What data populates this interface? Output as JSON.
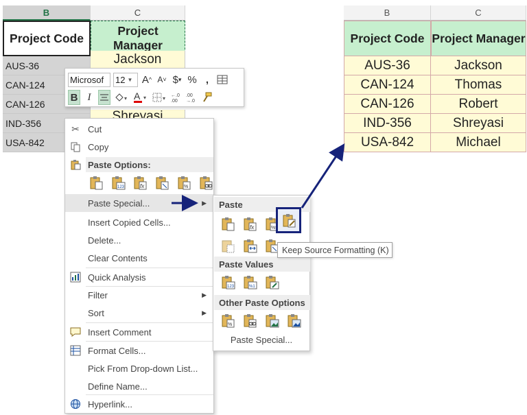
{
  "left_sheet": {
    "col_b": "B",
    "col_c": "C",
    "header_b": "Project Code",
    "header_c": "Project Manager",
    "codes": [
      "AUS-36",
      "CAN-124",
      "CAN-126",
      "IND-356",
      "USA-842"
    ],
    "managers_visible": [
      "Jackson",
      "Shreyasi"
    ]
  },
  "mini_toolbar": {
    "font_name": "Microsof",
    "font_size": "12",
    "grow_font": "A",
    "shrink_font": "A",
    "currency": "$",
    "percent": "%",
    "comma": ",",
    "bold": "B",
    "italic": "I"
  },
  "context_menu": {
    "cut": "Cut",
    "copy": "Copy",
    "paste_options_header": "Paste Options:",
    "paste_special": "Paste Special...",
    "insert_copied_cells": "Insert Copied Cells...",
    "delete": "Delete...",
    "clear_contents": "Clear Contents",
    "quick_analysis": "Quick Analysis",
    "filter": "Filter",
    "sort": "Sort",
    "insert_comment": "Insert Comment",
    "format_cells": "Format Cells...",
    "pick_from_list": "Pick From Drop-down List...",
    "define_name": "Define Name...",
    "hyperlink": "Hyperlink..."
  },
  "submenu": {
    "paste_header": "Paste",
    "paste_values_header": "Paste Values",
    "other_paste_header": "Other Paste Options",
    "paste_special": "Paste Special..."
  },
  "tooltip": "Keep Source Formatting (K)",
  "right_sheet": {
    "col_b": "B",
    "col_c": "C",
    "header_b": "Project Code",
    "header_c": "Project Manager",
    "rows": [
      {
        "code": "AUS-36",
        "manager": "Jackson"
      },
      {
        "code": "CAN-124",
        "manager": "Thomas"
      },
      {
        "code": "CAN-126",
        "manager": "Robert"
      },
      {
        "code": "IND-356",
        "manager": "Shreyasi"
      },
      {
        "code": "USA-842",
        "manager": "Michael"
      }
    ]
  },
  "colors": {
    "excel_green": "#217346",
    "header_green_fill": "#c6efce",
    "cell_yellow_fill": "#fffbd6",
    "annotation_blue": "#16237a"
  }
}
